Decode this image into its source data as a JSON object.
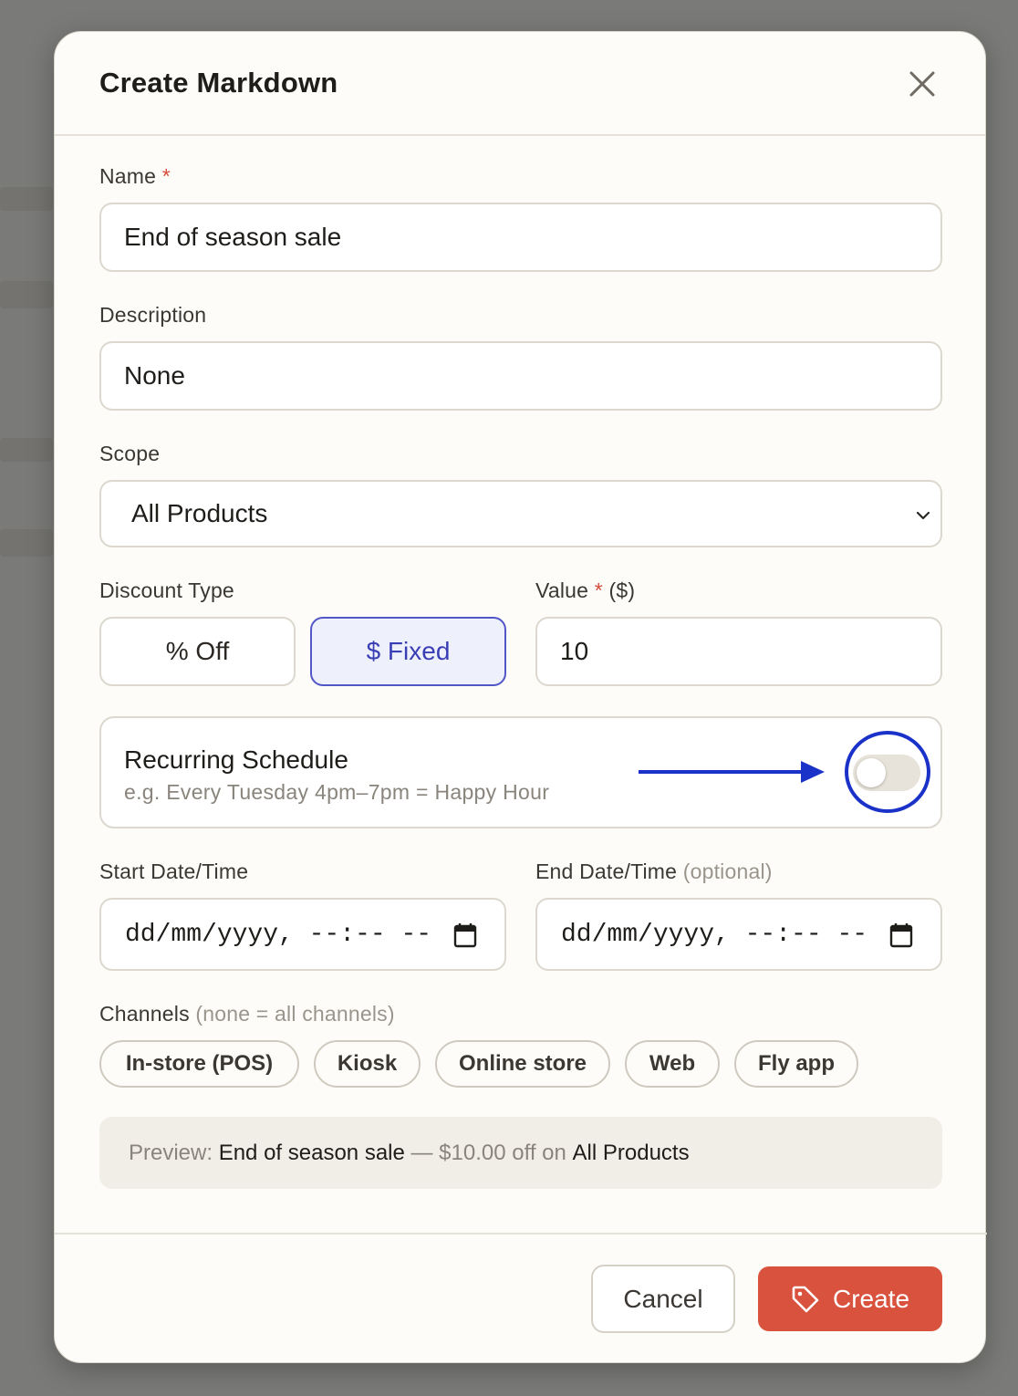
{
  "modal": {
    "title": "Create Markdown",
    "close_icon": "close-icon"
  },
  "name": {
    "label": "Name",
    "required_mark": "*",
    "value": "End of season sale"
  },
  "description": {
    "label": "Description",
    "value": "None"
  },
  "scope": {
    "label": "Scope",
    "selected": "All Products",
    "icon": "chevron-down-icon"
  },
  "discount_type": {
    "label": "Discount Type",
    "options": [
      "% Off",
      "$ Fixed"
    ],
    "selected": "$ Fixed"
  },
  "value": {
    "label": "Value",
    "required_mark": "*",
    "unit": "($)",
    "value": "10"
  },
  "recurring": {
    "title": "Recurring Schedule",
    "subtitle": "e.g. Every Tuesday 4pm–7pm = Happy Hour",
    "enabled": false,
    "annotation_color": "#1a32c8"
  },
  "start_date": {
    "label": "Start Date/Time",
    "placeholder": "dd/mm/yyyy, --:-- --",
    "icon": "calendar-icon"
  },
  "end_date": {
    "label": "End Date/Time",
    "hint": "(optional)",
    "placeholder": "dd/mm/yyyy, --:-- --",
    "icon": "calendar-icon"
  },
  "channels": {
    "label": "Channels",
    "hint": "(none = all channels)",
    "items": [
      "In-store (POS)",
      "Kiosk",
      "Online store",
      "Web",
      "Fly app"
    ]
  },
  "preview": {
    "prefix": "Preview:",
    "name": "End of season sale",
    "middle": "— $10.00 off on",
    "scope": "All Products"
  },
  "footer": {
    "cancel_label": "Cancel",
    "create_label": "Create",
    "create_icon": "tag-icon",
    "accent": "#d9523d"
  }
}
